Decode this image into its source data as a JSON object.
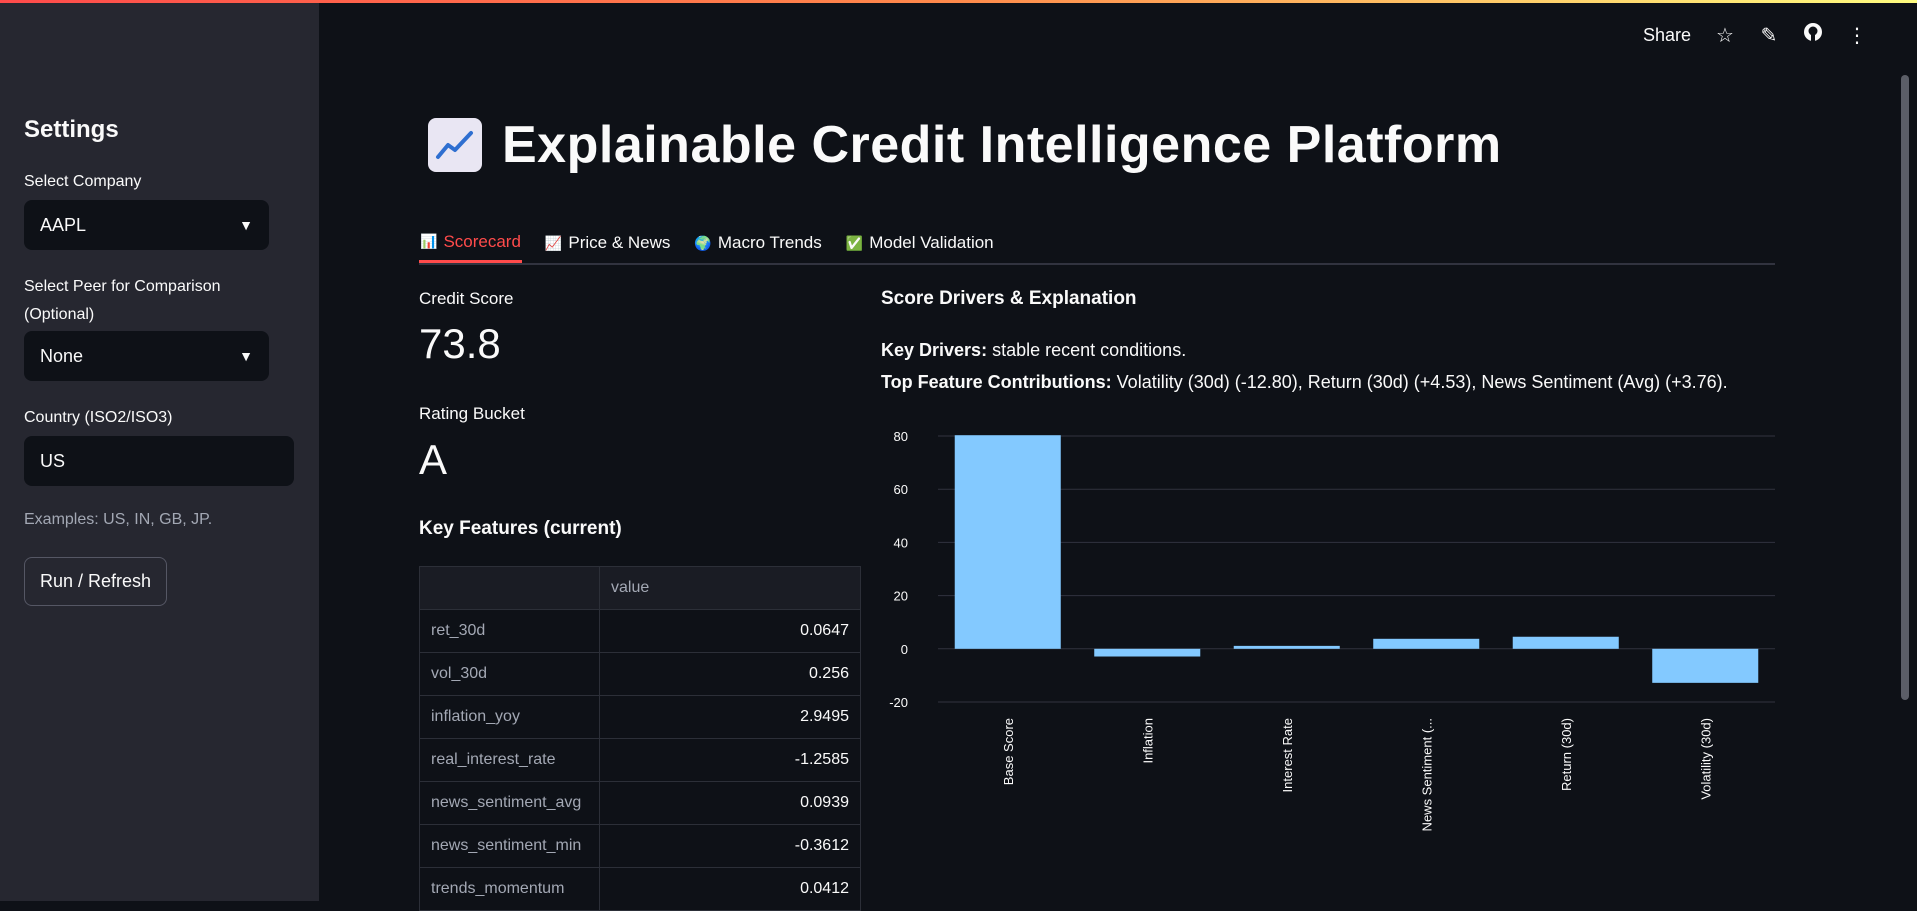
{
  "sidebar": {
    "title": "Settings",
    "company_label": "Select Company",
    "company_value": "AAPL",
    "peer_label": "Select Peer for Comparison (Optional)",
    "peer_value": "None",
    "country_label": "Country (ISO2/ISO3)",
    "country_value": "US",
    "country_help": "Examples: US, IN, GB, JP.",
    "run_button": "Run / Refresh"
  },
  "toolbar": {
    "share_label": "Share"
  },
  "header": {
    "title": "Explainable Credit Intelligence Platform",
    "emoji": "chart-increasing-icon"
  },
  "tabs": [
    {
      "label": "Scorecard",
      "icon": "bar-chart-icon"
    },
    {
      "label": "Price & News",
      "icon": "chart-increasing-icon"
    },
    {
      "label": "Macro Trends",
      "icon": "globe-icon"
    },
    {
      "label": "Model Validation",
      "icon": "check-box-icon"
    }
  ],
  "metrics": {
    "credit_score_label": "Credit Score",
    "credit_score_value": "73.8",
    "rating_label": "Rating Bucket",
    "rating_value": "A"
  },
  "features": {
    "title": "Key Features (current)",
    "header": [
      "",
      "value"
    ],
    "rows": [
      [
        "ret_30d",
        "0.0647"
      ],
      [
        "vol_30d",
        "0.256"
      ],
      [
        "inflation_yoy",
        "2.9495"
      ],
      [
        "real_interest_rate",
        "-1.2585"
      ],
      [
        "news_sentiment_avg",
        "0.0939"
      ],
      [
        "news_sentiment_min",
        "-0.3612"
      ],
      [
        "trends_momentum",
        "0.0412"
      ]
    ]
  },
  "explanation": {
    "title": "Score Drivers & Explanation",
    "key_drivers_label": "Key Drivers:",
    "key_drivers_text": "stable recent conditions.",
    "top_label": "Top Feature Contributions:",
    "top_text": "Volatility (30d) (-12.80), Return (30d) (+4.53), News Sentiment (Avg) (+3.76)."
  },
  "chart_data": {
    "type": "bar",
    "categories": [
      "Base Score",
      "Inflation",
      "Interest Rate",
      "News Sentiment (...",
      "Return (30d)",
      "Volatility (30d)"
    ],
    "values": [
      80.3,
      -2.9,
      1.1,
      3.76,
      4.53,
      -12.8
    ],
    "yticks": [
      80,
      60,
      40,
      20,
      0,
      -20
    ],
    "ylim": [
      -20,
      80
    ],
    "grid": true,
    "bar_color": "#83c9ff"
  },
  "colors": {
    "accent": "#ff4b4b",
    "bar": "#83c9ff",
    "background": "#0e1117",
    "sidebar": "#262730"
  }
}
